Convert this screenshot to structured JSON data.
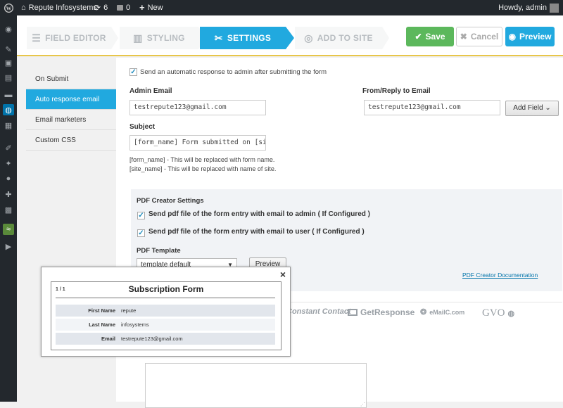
{
  "adminbar": {
    "site_name": "Repute Infosystems",
    "updates_count": "6",
    "comments_count": "0",
    "new_label": "New",
    "howdy": "Howdy, admin"
  },
  "steps": {
    "field_editor": "FIELD EDITOR",
    "styling": "STYLING",
    "settings": "SETTINGS",
    "add_to_site": "ADD TO SITE"
  },
  "buttons": {
    "save": "Save",
    "cancel": "Cancel",
    "preview": "Preview"
  },
  "leftnav": {
    "items": [
      "On Submit",
      "Auto response email",
      "Email marketers",
      "Custom CSS"
    ],
    "active_index": 1
  },
  "form": {
    "auto_response_label": "Send an automatic response to admin after submitting the form",
    "auto_response_checked": true,
    "admin_email_label": "Admin Email",
    "admin_email_value": "testrepute123@gmail.com",
    "from_reply_label": "From/Reply to Email",
    "from_reply_value": "testrepute123@gmail.com",
    "add_field_label": "Add Field",
    "subject_label": "Subject",
    "subject_value": "[form_name] Form submitted on [site",
    "hint_form_name": "[form_name] - This will be replaced with form name.",
    "hint_site_name": "[site_name] - This will be replaced with name of site."
  },
  "pdf": {
    "heading": "PDF Creator Settings",
    "send_admin": "Send pdf file of the form entry with email to admin ( If Configured )",
    "send_user": "Send pdf file of the form entry with email to user ( If Configured )",
    "template_label": "PDF Template",
    "template_value": "template default",
    "preview_label": "Preview",
    "doc_link": "PDF Creator Documentation"
  },
  "logos": [
    "Constant Contact",
    "GetResponse",
    "eMailC.com",
    "GVO"
  ],
  "popup": {
    "close": "×",
    "page_indicator": "1 / 1",
    "title": "Subscription Form",
    "rows": [
      {
        "key": "First Name",
        "value": "repute"
      },
      {
        "key": "Last Name",
        "value": "infosystems"
      },
      {
        "key": "Email",
        "value": "testrepute123@gmail.com"
      }
    ]
  },
  "colors": {
    "accent_blue": "#21a9df",
    "save_green": "#5cb85c",
    "admin_bar": "#23282d"
  }
}
